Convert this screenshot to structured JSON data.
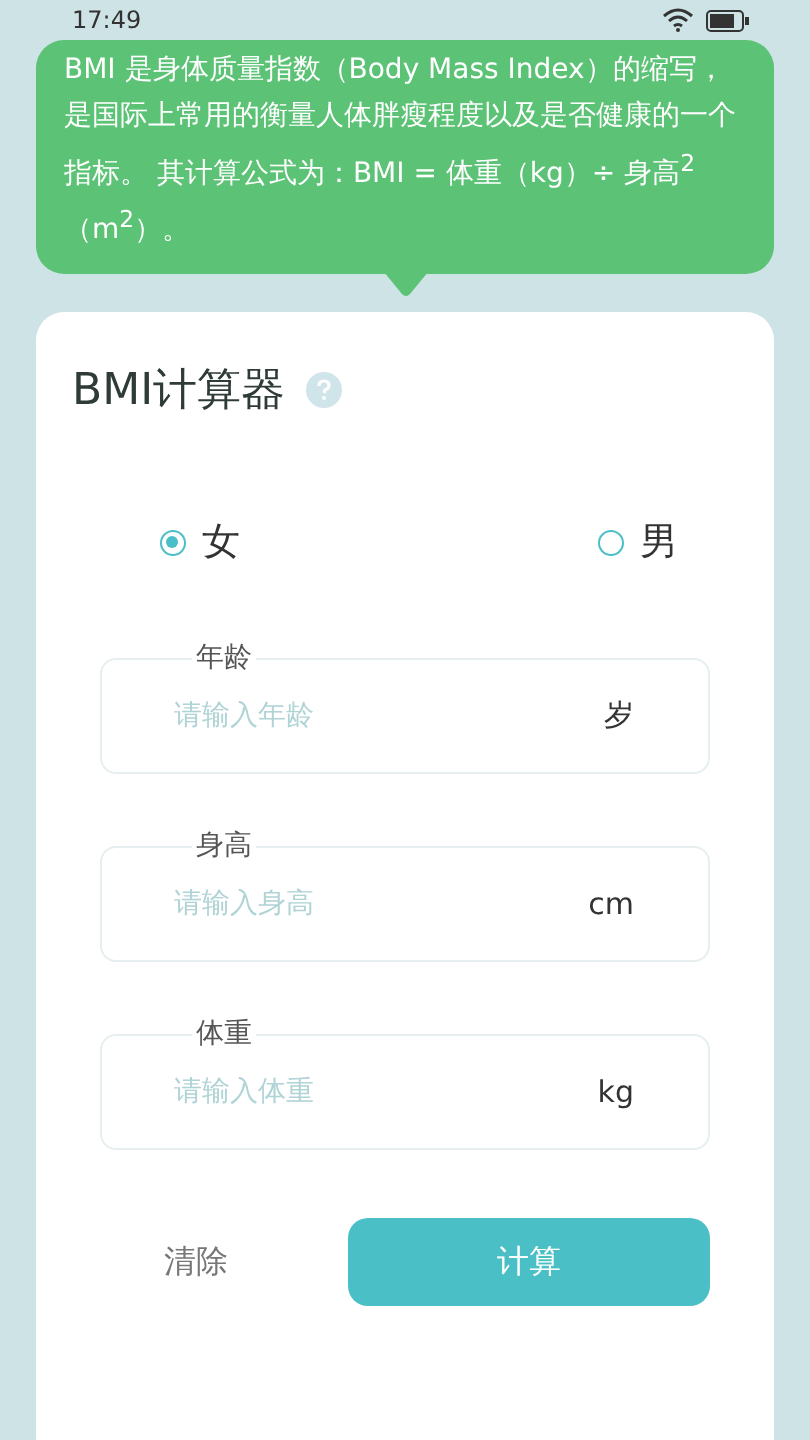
{
  "status_bar": {
    "time": "17:49"
  },
  "tooltip": {
    "text": "BMI 是身体质量指数（Body Mass Index）的缩写，是国际上常用的衡量人体胖瘦程度以及是否健康的一个指标。 其计算公式为：BMI = 体重（kg）÷ 身高$^{2}$（m$^{2}$）。"
  },
  "card": {
    "title": "BMI计算器",
    "gender": [
      {
        "label": "女",
        "selected": true
      },
      {
        "label": "男",
        "selected": false
      }
    ],
    "fields": [
      {
        "label": "年龄",
        "placeholder": "请输入年龄",
        "unit": "岁"
      },
      {
        "label": "身高",
        "placeholder": "请输入身高",
        "unit": "cm"
      },
      {
        "label": "体重",
        "placeholder": "请输入体重",
        "unit": "kg"
      }
    ],
    "buttons": [
      {
        "kind": "text",
        "label": "清除"
      },
      {
        "kind": "primary",
        "label": "计算"
      }
    ]
  }
}
